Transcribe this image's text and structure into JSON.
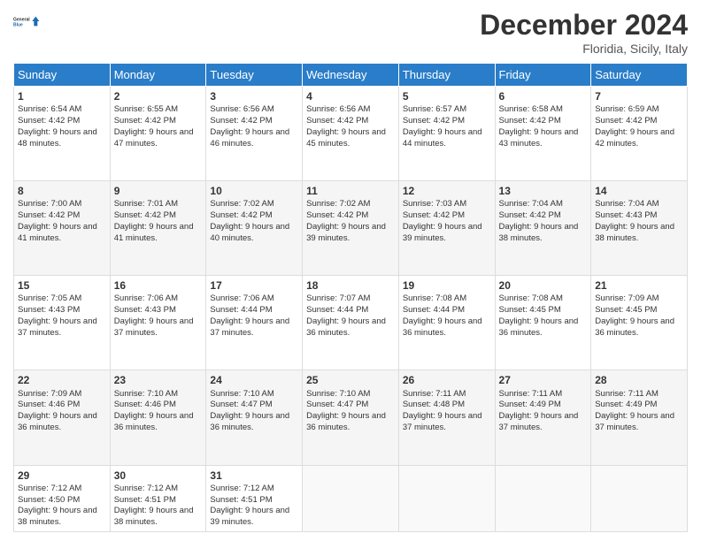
{
  "header": {
    "logo_line1": "General",
    "logo_line2": "Blue",
    "title": "December 2024",
    "location": "Floridia, Sicily, Italy"
  },
  "days_of_week": [
    "Sunday",
    "Monday",
    "Tuesday",
    "Wednesday",
    "Thursday",
    "Friday",
    "Saturday"
  ],
  "weeks": [
    [
      {
        "day": "1",
        "sunrise": "6:54 AM",
        "sunset": "4:42 PM",
        "daylight": "9 hours and 48 minutes."
      },
      {
        "day": "2",
        "sunrise": "6:55 AM",
        "sunset": "4:42 PM",
        "daylight": "9 hours and 47 minutes."
      },
      {
        "day": "3",
        "sunrise": "6:56 AM",
        "sunset": "4:42 PM",
        "daylight": "9 hours and 46 minutes."
      },
      {
        "day": "4",
        "sunrise": "6:56 AM",
        "sunset": "4:42 PM",
        "daylight": "9 hours and 45 minutes."
      },
      {
        "day": "5",
        "sunrise": "6:57 AM",
        "sunset": "4:42 PM",
        "daylight": "9 hours and 44 minutes."
      },
      {
        "day": "6",
        "sunrise": "6:58 AM",
        "sunset": "4:42 PM",
        "daylight": "9 hours and 43 minutes."
      },
      {
        "day": "7",
        "sunrise": "6:59 AM",
        "sunset": "4:42 PM",
        "daylight": "9 hours and 42 minutes."
      }
    ],
    [
      {
        "day": "8",
        "sunrise": "7:00 AM",
        "sunset": "4:42 PM",
        "daylight": "9 hours and 41 minutes."
      },
      {
        "day": "9",
        "sunrise": "7:01 AM",
        "sunset": "4:42 PM",
        "daylight": "9 hours and 41 minutes."
      },
      {
        "day": "10",
        "sunrise": "7:02 AM",
        "sunset": "4:42 PM",
        "daylight": "9 hours and 40 minutes."
      },
      {
        "day": "11",
        "sunrise": "7:02 AM",
        "sunset": "4:42 PM",
        "daylight": "9 hours and 39 minutes."
      },
      {
        "day": "12",
        "sunrise": "7:03 AM",
        "sunset": "4:42 PM",
        "daylight": "9 hours and 39 minutes."
      },
      {
        "day": "13",
        "sunrise": "7:04 AM",
        "sunset": "4:42 PM",
        "daylight": "9 hours and 38 minutes."
      },
      {
        "day": "14",
        "sunrise": "7:04 AM",
        "sunset": "4:43 PM",
        "daylight": "9 hours and 38 minutes."
      }
    ],
    [
      {
        "day": "15",
        "sunrise": "7:05 AM",
        "sunset": "4:43 PM",
        "daylight": "9 hours and 37 minutes."
      },
      {
        "day": "16",
        "sunrise": "7:06 AM",
        "sunset": "4:43 PM",
        "daylight": "9 hours and 37 minutes."
      },
      {
        "day": "17",
        "sunrise": "7:06 AM",
        "sunset": "4:44 PM",
        "daylight": "9 hours and 37 minutes."
      },
      {
        "day": "18",
        "sunrise": "7:07 AM",
        "sunset": "4:44 PM",
        "daylight": "9 hours and 36 minutes."
      },
      {
        "day": "19",
        "sunrise": "7:08 AM",
        "sunset": "4:44 PM",
        "daylight": "9 hours and 36 minutes."
      },
      {
        "day": "20",
        "sunrise": "7:08 AM",
        "sunset": "4:45 PM",
        "daylight": "9 hours and 36 minutes."
      },
      {
        "day": "21",
        "sunrise": "7:09 AM",
        "sunset": "4:45 PM",
        "daylight": "9 hours and 36 minutes."
      }
    ],
    [
      {
        "day": "22",
        "sunrise": "7:09 AM",
        "sunset": "4:46 PM",
        "daylight": "9 hours and 36 minutes."
      },
      {
        "day": "23",
        "sunrise": "7:10 AM",
        "sunset": "4:46 PM",
        "daylight": "9 hours and 36 minutes."
      },
      {
        "day": "24",
        "sunrise": "7:10 AM",
        "sunset": "4:47 PM",
        "daylight": "9 hours and 36 minutes."
      },
      {
        "day": "25",
        "sunrise": "7:10 AM",
        "sunset": "4:47 PM",
        "daylight": "9 hours and 36 minutes."
      },
      {
        "day": "26",
        "sunrise": "7:11 AM",
        "sunset": "4:48 PM",
        "daylight": "9 hours and 37 minutes."
      },
      {
        "day": "27",
        "sunrise": "7:11 AM",
        "sunset": "4:49 PM",
        "daylight": "9 hours and 37 minutes."
      },
      {
        "day": "28",
        "sunrise": "7:11 AM",
        "sunset": "4:49 PM",
        "daylight": "9 hours and 37 minutes."
      }
    ],
    [
      {
        "day": "29",
        "sunrise": "7:12 AM",
        "sunset": "4:50 PM",
        "daylight": "9 hours and 38 minutes."
      },
      {
        "day": "30",
        "sunrise": "7:12 AM",
        "sunset": "4:51 PM",
        "daylight": "9 hours and 38 minutes."
      },
      {
        "day": "31",
        "sunrise": "7:12 AM",
        "sunset": "4:51 PM",
        "daylight": "9 hours and 39 minutes."
      },
      null,
      null,
      null,
      null
    ]
  ],
  "labels": {
    "sunrise_prefix": "Sunrise: ",
    "sunset_prefix": "Sunset: ",
    "daylight_prefix": "Daylight: "
  }
}
